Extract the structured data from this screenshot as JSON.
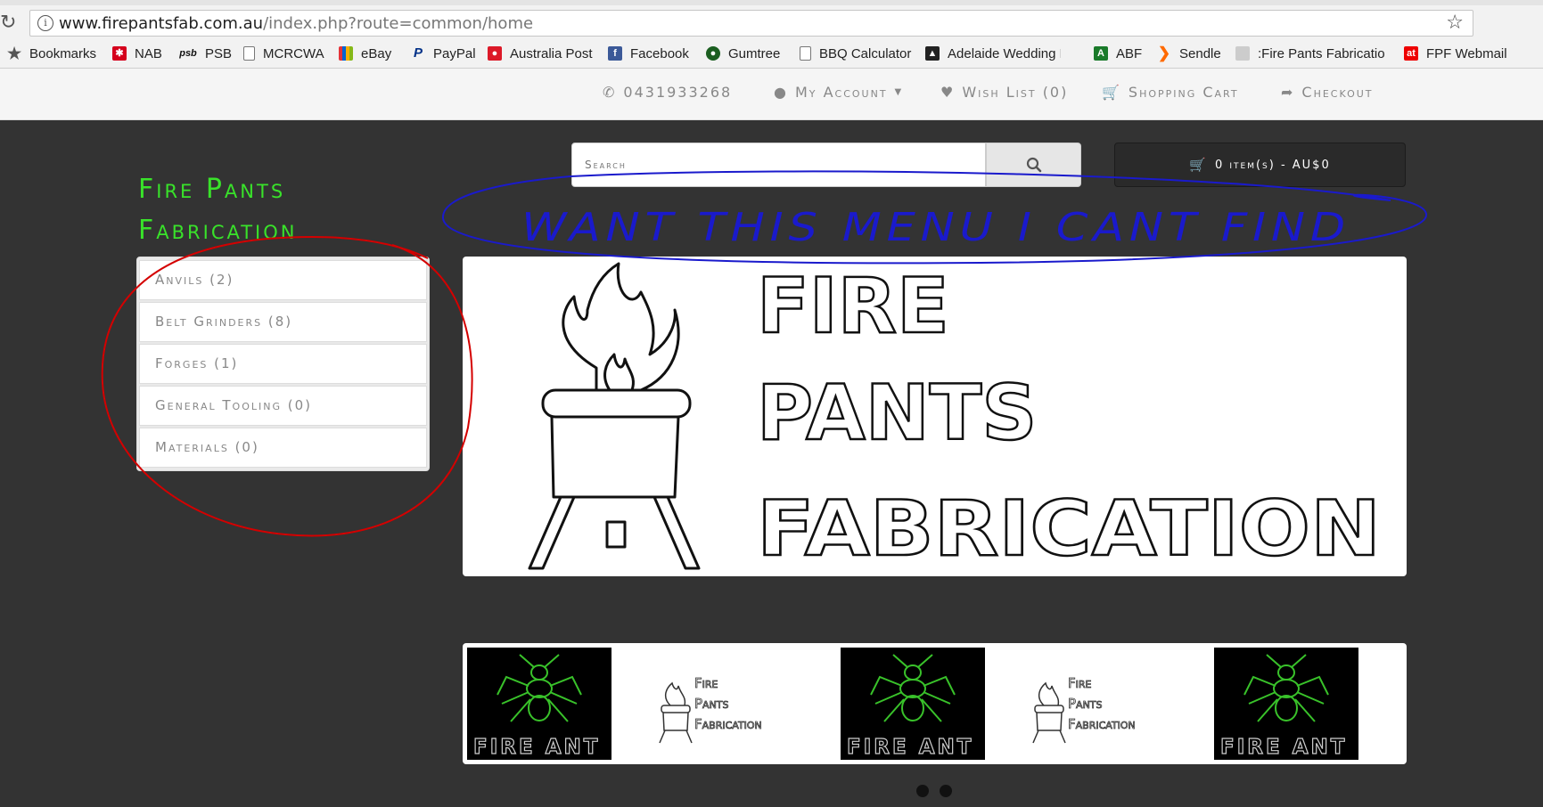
{
  "browser": {
    "url_host": "www.firepantsfab.com.au",
    "url_path": "/index.php?route=common/home",
    "bookmarks": [
      {
        "label": "Bookmarks",
        "icon": "star-icon"
      },
      {
        "label": "NAB",
        "icon": "nab-icon"
      },
      {
        "label": "PSB",
        "icon": "psb-icon"
      },
      {
        "label": "MCRCWA",
        "icon": "page-icon"
      },
      {
        "label": "eBay",
        "icon": "ebay-icon"
      },
      {
        "label": "PayPal",
        "icon": "paypal-icon"
      },
      {
        "label": "Australia Post",
        "icon": "auspost-icon"
      },
      {
        "label": "Facebook",
        "icon": "facebook-icon"
      },
      {
        "label": "Gumtree",
        "icon": "gumtree-icon"
      },
      {
        "label": "BBQ Calculator",
        "icon": "page-icon"
      },
      {
        "label": "Adelaide Wedding Ph",
        "icon": "wedding-icon"
      },
      {
        "label": "ABF",
        "icon": "abf-icon"
      },
      {
        "label": "Sendle",
        "icon": "sendle-icon"
      },
      {
        "label": ":Fire Pants Fabrication",
        "icon": "fpf-icon"
      },
      {
        "label": "FPF Webmail",
        "icon": "webmail-icon"
      }
    ]
  },
  "topbar": {
    "phone": "0431933268",
    "my_account": "My Account",
    "wish_list": "Wish List (0)",
    "shopping_cart": "Shopping Cart",
    "checkout": "Checkout"
  },
  "store": {
    "name_line1": "Fire Pants",
    "name_line2": "Fabrication",
    "search_placeholder": "Search",
    "cart_summary": "0 item(s) - AU$0"
  },
  "categories": [
    "Anvils (2)",
    "Belt Grinders (8)",
    "Forges (1)",
    "General Tooling (0)",
    "Materials (0)"
  ],
  "hero": {
    "word1": "FIRE",
    "word2": "PANTS",
    "word3": "FABRICATION"
  },
  "carousel": {
    "fire_ant_label": "FIRE ANT",
    "fpf_line1": "Fire",
    "fpf_line2": "Pants",
    "fpf_line3": "Fabrication"
  },
  "annotation": {
    "handwritten_text": "WANT THIS MENU I CANT FIND"
  },
  "colors": {
    "page_bg": "#333333",
    "brand_green": "#39e22a",
    "annotation_blue": "#1a1acc",
    "annotation_red": "#d40000"
  }
}
